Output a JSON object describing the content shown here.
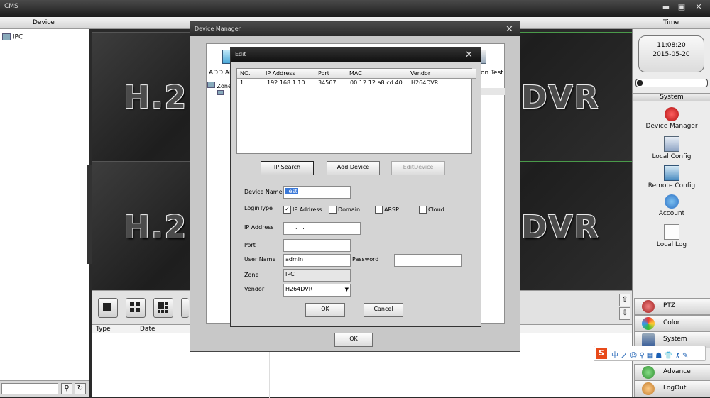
{
  "window": {
    "title": "CMS",
    "min": "▬",
    "max": "▣",
    "close": "✕"
  },
  "header": {
    "device": "Device",
    "time": "Time"
  },
  "tree": {
    "root": "IPC"
  },
  "video": {
    "watermark_left": "H.2",
    "watermark_right": "DVR"
  },
  "log": {
    "col_type": "Type",
    "col_date": "Date"
  },
  "clock": {
    "time": "11:08:20",
    "date": "2015-05-20"
  },
  "system": {
    "header": "System",
    "items": [
      {
        "label": "Device Manager",
        "icon": "device-manager-icon",
        "color": "#d21d1d"
      },
      {
        "label": "Local Config",
        "icon": "local-config-icon",
        "color": "#4f6d9c"
      },
      {
        "label": "Remote Config",
        "icon": "remote-config-icon",
        "color": "#3c8fc0"
      },
      {
        "label": "Account",
        "icon": "account-icon",
        "color": "#2b7fd4"
      },
      {
        "label": "Local Log",
        "icon": "local-log-icon",
        "color": "#f0f0f0"
      }
    ]
  },
  "bottom_buttons": [
    {
      "label": "PTZ",
      "icon": "ptz-icon",
      "color": "#c03030"
    },
    {
      "label": "Color",
      "icon": "color-icon",
      "color": "#3a9a3a"
    },
    {
      "label": "System",
      "icon": "system-icon",
      "color": "#3b5f9a"
    },
    {
      "label": "Advance",
      "icon": "advance-icon",
      "color": "#2f8f2f"
    },
    {
      "label": "LogOut",
      "icon": "logout-icon",
      "color": "#c07a2a"
    }
  ],
  "device_manager": {
    "title": "Device Manager",
    "add_area": "ADD AR",
    "test": "on Test",
    "zone": "Zone",
    "ok": "OK"
  },
  "edit": {
    "title": "Edit",
    "columns": [
      "NO.",
      "IP Address",
      "Port",
      "MAC",
      "Vendor"
    ],
    "rows": [
      {
        "no": "1",
        "ip": "192.168.1.10",
        "port": "34567",
        "mac": "00:12:12:a8:cd:40",
        "vendor": "H264DVR"
      }
    ],
    "buttons": {
      "ip_search": "IP Search",
      "add_device": "Add Device",
      "edit_device": "EditDevice",
      "ok": "OK",
      "cancel": "Cancel"
    },
    "form": {
      "device_name_label": "Device Name",
      "device_name": "Test",
      "login_type_label": "LoginType",
      "login_types": [
        {
          "label": "IP Address",
          "checked": true
        },
        {
          "label": "Domain",
          "checked": false
        },
        {
          "label": "ARSP",
          "checked": false
        },
        {
          "label": "Cloud",
          "checked": false
        }
      ],
      "ip_label": "IP Address",
      "ip_value": ".       .       .",
      "port_label": "Port",
      "port_value": "",
      "user_label": "User Name",
      "user_value": "admin",
      "password_label": "Password",
      "password_value": "",
      "zone_label": "Zone",
      "zone_value": "IPC",
      "vendor_label": "Vendor",
      "vendor_value": "H264DVR"
    }
  },
  "ime": {
    "logo": "S",
    "items": [
      "中",
      "ノ",
      "☺",
      "⚲",
      "▦",
      "☗",
      "👕",
      "⚷",
      "✎"
    ]
  }
}
